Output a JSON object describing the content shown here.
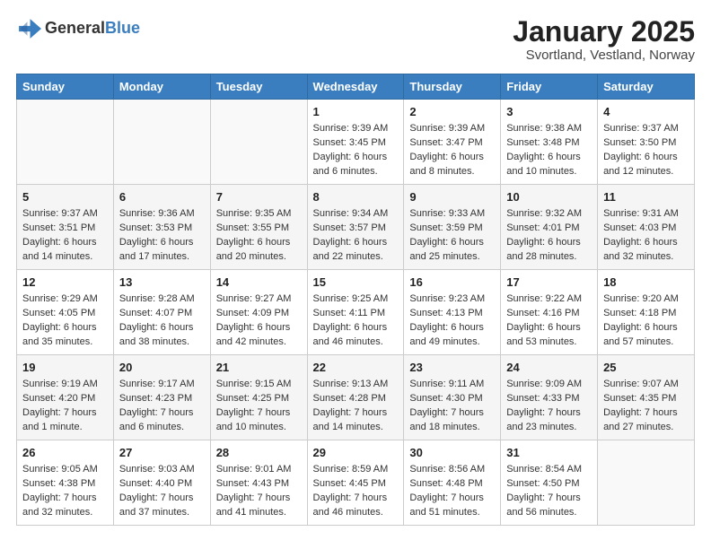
{
  "header": {
    "logo_general": "General",
    "logo_blue": "Blue",
    "title": "January 2025",
    "subtitle": "Svortland, Vestland, Norway"
  },
  "weekdays": [
    "Sunday",
    "Monday",
    "Tuesday",
    "Wednesday",
    "Thursday",
    "Friday",
    "Saturday"
  ],
  "weeks": [
    [
      {
        "day": "",
        "content": ""
      },
      {
        "day": "",
        "content": ""
      },
      {
        "day": "",
        "content": ""
      },
      {
        "day": "1",
        "content": "Sunrise: 9:39 AM\nSunset: 3:45 PM\nDaylight: 6 hours\nand 6 minutes."
      },
      {
        "day": "2",
        "content": "Sunrise: 9:39 AM\nSunset: 3:47 PM\nDaylight: 6 hours\nand 8 minutes."
      },
      {
        "day": "3",
        "content": "Sunrise: 9:38 AM\nSunset: 3:48 PM\nDaylight: 6 hours\nand 10 minutes."
      },
      {
        "day": "4",
        "content": "Sunrise: 9:37 AM\nSunset: 3:50 PM\nDaylight: 6 hours\nand 12 minutes."
      }
    ],
    [
      {
        "day": "5",
        "content": "Sunrise: 9:37 AM\nSunset: 3:51 PM\nDaylight: 6 hours\nand 14 minutes."
      },
      {
        "day": "6",
        "content": "Sunrise: 9:36 AM\nSunset: 3:53 PM\nDaylight: 6 hours\nand 17 minutes."
      },
      {
        "day": "7",
        "content": "Sunrise: 9:35 AM\nSunset: 3:55 PM\nDaylight: 6 hours\nand 20 minutes."
      },
      {
        "day": "8",
        "content": "Sunrise: 9:34 AM\nSunset: 3:57 PM\nDaylight: 6 hours\nand 22 minutes."
      },
      {
        "day": "9",
        "content": "Sunrise: 9:33 AM\nSunset: 3:59 PM\nDaylight: 6 hours\nand 25 minutes."
      },
      {
        "day": "10",
        "content": "Sunrise: 9:32 AM\nSunset: 4:01 PM\nDaylight: 6 hours\nand 28 minutes."
      },
      {
        "day": "11",
        "content": "Sunrise: 9:31 AM\nSunset: 4:03 PM\nDaylight: 6 hours\nand 32 minutes."
      }
    ],
    [
      {
        "day": "12",
        "content": "Sunrise: 9:29 AM\nSunset: 4:05 PM\nDaylight: 6 hours\nand 35 minutes."
      },
      {
        "day": "13",
        "content": "Sunrise: 9:28 AM\nSunset: 4:07 PM\nDaylight: 6 hours\nand 38 minutes."
      },
      {
        "day": "14",
        "content": "Sunrise: 9:27 AM\nSunset: 4:09 PM\nDaylight: 6 hours\nand 42 minutes."
      },
      {
        "day": "15",
        "content": "Sunrise: 9:25 AM\nSunset: 4:11 PM\nDaylight: 6 hours\nand 46 minutes."
      },
      {
        "day": "16",
        "content": "Sunrise: 9:23 AM\nSunset: 4:13 PM\nDaylight: 6 hours\nand 49 minutes."
      },
      {
        "day": "17",
        "content": "Sunrise: 9:22 AM\nSunset: 4:16 PM\nDaylight: 6 hours\nand 53 minutes."
      },
      {
        "day": "18",
        "content": "Sunrise: 9:20 AM\nSunset: 4:18 PM\nDaylight: 6 hours\nand 57 minutes."
      }
    ],
    [
      {
        "day": "19",
        "content": "Sunrise: 9:19 AM\nSunset: 4:20 PM\nDaylight: 7 hours\nand 1 minute."
      },
      {
        "day": "20",
        "content": "Sunrise: 9:17 AM\nSunset: 4:23 PM\nDaylight: 7 hours\nand 6 minutes."
      },
      {
        "day": "21",
        "content": "Sunrise: 9:15 AM\nSunset: 4:25 PM\nDaylight: 7 hours\nand 10 minutes."
      },
      {
        "day": "22",
        "content": "Sunrise: 9:13 AM\nSunset: 4:28 PM\nDaylight: 7 hours\nand 14 minutes."
      },
      {
        "day": "23",
        "content": "Sunrise: 9:11 AM\nSunset: 4:30 PM\nDaylight: 7 hours\nand 18 minutes."
      },
      {
        "day": "24",
        "content": "Sunrise: 9:09 AM\nSunset: 4:33 PM\nDaylight: 7 hours\nand 23 minutes."
      },
      {
        "day": "25",
        "content": "Sunrise: 9:07 AM\nSunset: 4:35 PM\nDaylight: 7 hours\nand 27 minutes."
      }
    ],
    [
      {
        "day": "26",
        "content": "Sunrise: 9:05 AM\nSunset: 4:38 PM\nDaylight: 7 hours\nand 32 minutes."
      },
      {
        "day": "27",
        "content": "Sunrise: 9:03 AM\nSunset: 4:40 PM\nDaylight: 7 hours\nand 37 minutes."
      },
      {
        "day": "28",
        "content": "Sunrise: 9:01 AM\nSunset: 4:43 PM\nDaylight: 7 hours\nand 41 minutes."
      },
      {
        "day": "29",
        "content": "Sunrise: 8:59 AM\nSunset: 4:45 PM\nDaylight: 7 hours\nand 46 minutes."
      },
      {
        "day": "30",
        "content": "Sunrise: 8:56 AM\nSunset: 4:48 PM\nDaylight: 7 hours\nand 51 minutes."
      },
      {
        "day": "31",
        "content": "Sunrise: 8:54 AM\nSunset: 4:50 PM\nDaylight: 7 hours\nand 56 minutes."
      },
      {
        "day": "",
        "content": ""
      }
    ]
  ]
}
